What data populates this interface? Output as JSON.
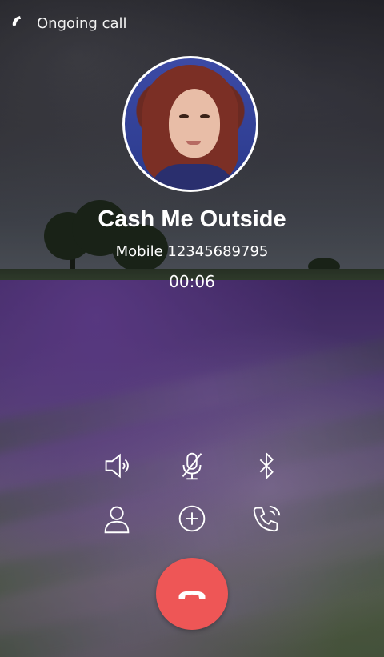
{
  "status_bar": {
    "text": "Ongoing call",
    "icon": "phone-icon"
  },
  "caller": {
    "name": "Cash Me Outside",
    "number": "Mobile 12345689795",
    "duration": "00:06"
  },
  "controls": [
    {
      "name": "speaker",
      "icon": "speaker-icon"
    },
    {
      "name": "mute",
      "icon": "microphone-off-icon"
    },
    {
      "name": "bluetooth",
      "icon": "bluetooth-icon"
    },
    {
      "name": "contacts",
      "icon": "person-icon"
    },
    {
      "name": "add-call",
      "icon": "plus-circle-icon"
    },
    {
      "name": "call-options",
      "icon": "phone-waves-icon"
    }
  ],
  "end_call": {
    "icon": "end-call-icon",
    "color": "#ee5656"
  }
}
